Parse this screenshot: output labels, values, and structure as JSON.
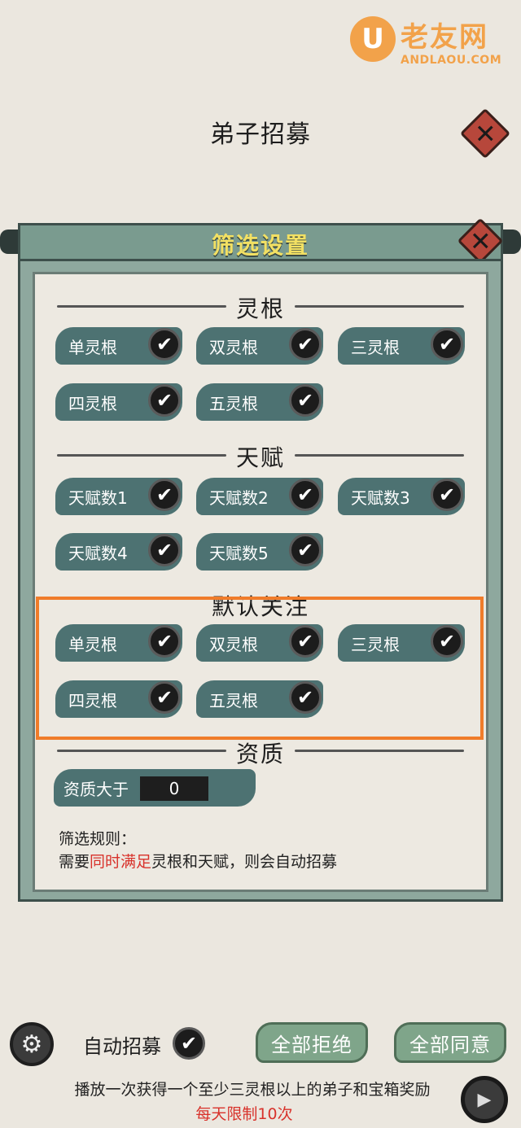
{
  "watermark": {
    "logo": "U",
    "title": "老友网",
    "subtitle": "ANDLAOU.COM"
  },
  "header": {
    "title": "弟子招募",
    "close_icon": "✕"
  },
  "panel": {
    "title": "筛选设置",
    "close_icon": "✕",
    "sections": {
      "linggen": {
        "title": "灵根",
        "items": [
          {
            "label": "单灵根",
            "checked": true
          },
          {
            "label": "双灵根",
            "checked": true
          },
          {
            "label": "三灵根",
            "checked": true
          },
          {
            "label": "四灵根",
            "checked": true
          },
          {
            "label": "五灵根",
            "checked": true
          }
        ]
      },
      "tianfu": {
        "title": "天赋",
        "items": [
          {
            "label": "天赋数1",
            "checked": true
          },
          {
            "label": "天赋数2",
            "checked": true
          },
          {
            "label": "天赋数3",
            "checked": true
          },
          {
            "label": "天赋数4",
            "checked": true
          },
          {
            "label": "天赋数5",
            "checked": true
          }
        ]
      },
      "focus": {
        "title": "默认关注",
        "items": [
          {
            "label": "单灵根",
            "checked": true
          },
          {
            "label": "双灵根",
            "checked": true
          },
          {
            "label": "三灵根",
            "checked": true
          },
          {
            "label": "四灵根",
            "checked": true
          },
          {
            "label": "五灵根",
            "checked": true
          }
        ]
      },
      "quality": {
        "title": "资质",
        "label": "资质大于",
        "value": "0"
      }
    },
    "rules": {
      "label": "筛选规则：",
      "prefix": "需要",
      "highlight": "同时满足",
      "suffix": "灵根和天赋，则会自动招募"
    }
  },
  "footer": {
    "auto_label": "自动招募",
    "auto_checked": true,
    "reject_all": "全部拒绝",
    "accept_all": "全部同意",
    "promo": "播放一次获得一个至少三灵根以上的弟子和宝箱奖励",
    "limit": "每天限制10次"
  },
  "icons": {
    "check": "✔",
    "settings": "⚙",
    "play": "▶"
  },
  "colors": {
    "accent_red": "#d8322b",
    "highlight_orange": "#f07c2a",
    "chip_teal": "#4d7272",
    "title_yellow": "#f2e063"
  }
}
